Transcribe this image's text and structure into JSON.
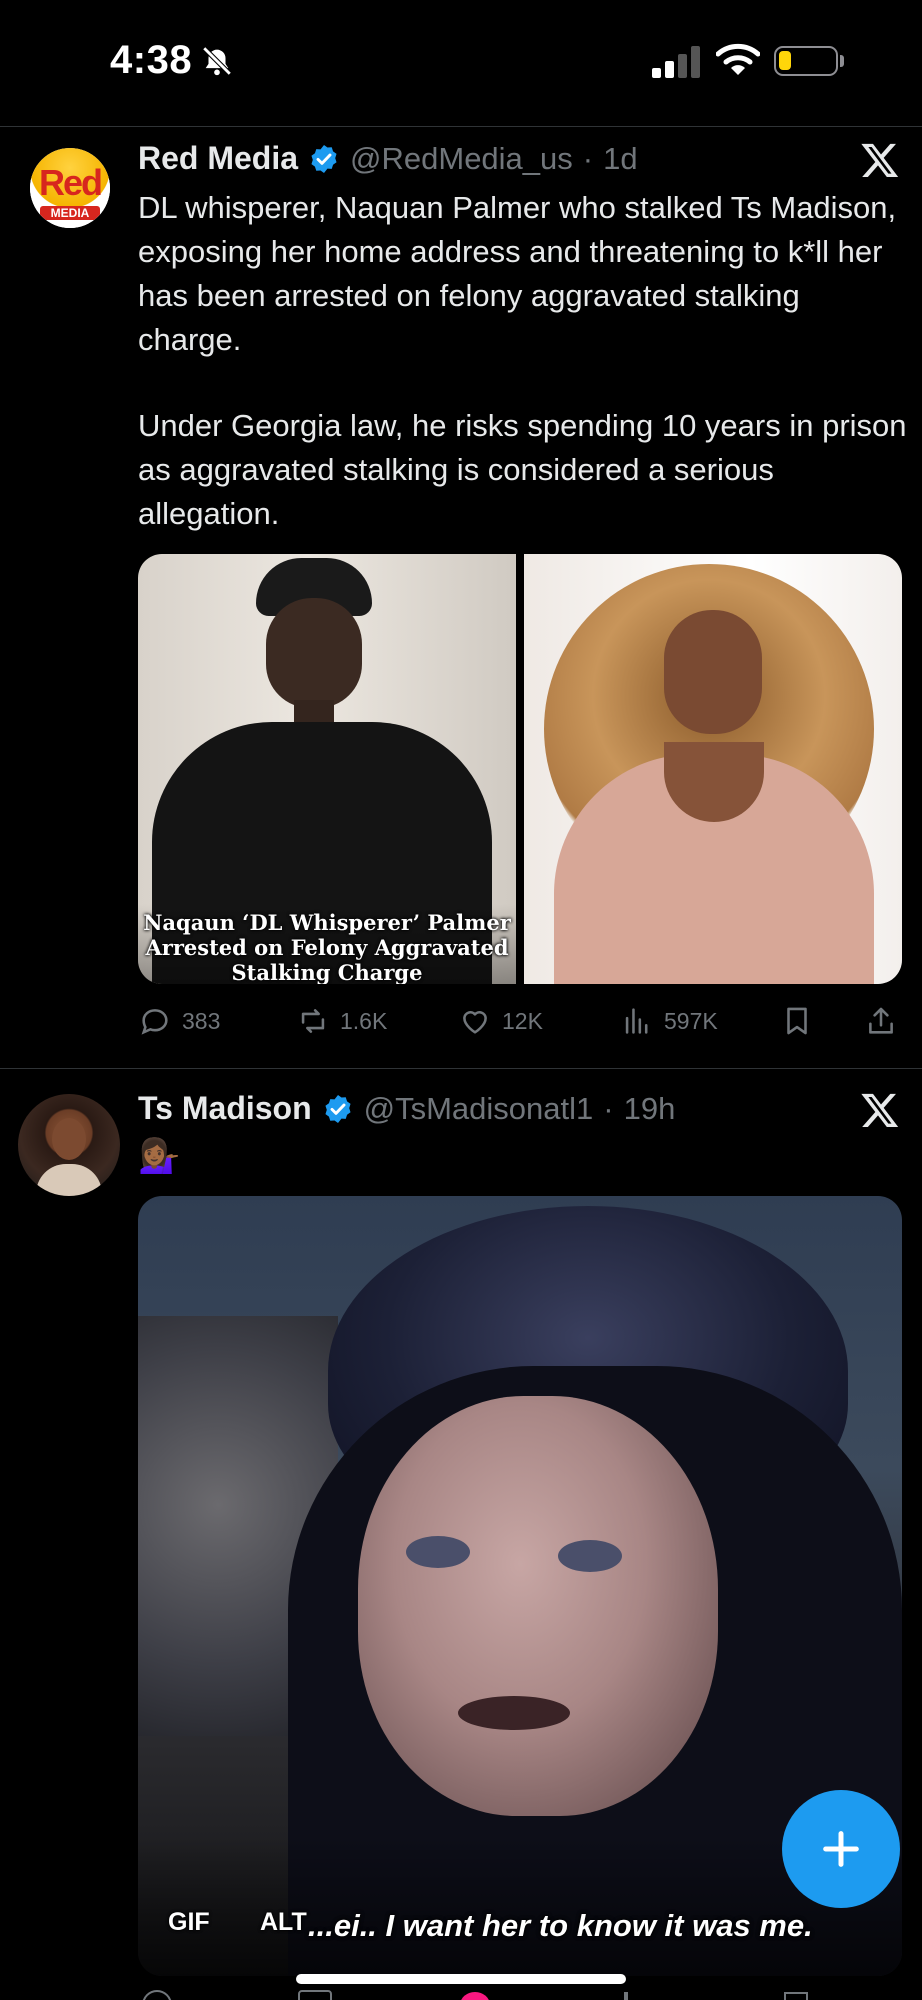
{
  "status_bar": {
    "time": "4:38"
  },
  "tweets": [
    {
      "avatar": {
        "logo_top": "Red",
        "logo_bottom": "MEDIA"
      },
      "name": "Red Media",
      "handle": "@RedMedia_us",
      "dot": "·",
      "time": "1d",
      "paragraphs": [
        "DL whisperer, Naquan Palmer who stalked Ts Madison, exposing her home address and threatening to k*ll her has been arrested on felony aggravated stalking charge.",
        "Under Georgia law, he risks spending 10 years in prison as aggravated stalking is considered a serious allegation."
      ],
      "image_caption": [
        "Naqaun ‘DL Whisperer’ Palmer",
        "Arrested on Felony Aggravated",
        "Stalking Charge"
      ],
      "actions": {
        "replies": "383",
        "reposts": "1.6K",
        "likes": "12K",
        "views": "597K"
      }
    },
    {
      "name": "Ts Madison",
      "handle": "@TsMadisonatl1",
      "dot": "·",
      "time": "19h",
      "emoji": "💁🏾‍♀️",
      "gif_badge": "GIF",
      "alt_badge": "ALT",
      "gif_subtitle": "...ei.. I want her to know it was me."
    }
  ],
  "colors": {
    "accent": "#1d9bf0",
    "background": "#000000",
    "muted": "#71767b",
    "verified": "#1d9bf0"
  },
  "icons": [
    "wifi-icon",
    "signal-icon",
    "battery-icon",
    "mute-bell-icon",
    "verified-icon",
    "x-logo-icon",
    "reply-icon",
    "repost-icon",
    "like-icon",
    "views-icon",
    "bookmark-icon",
    "share-icon",
    "compose-plus-icon"
  ]
}
